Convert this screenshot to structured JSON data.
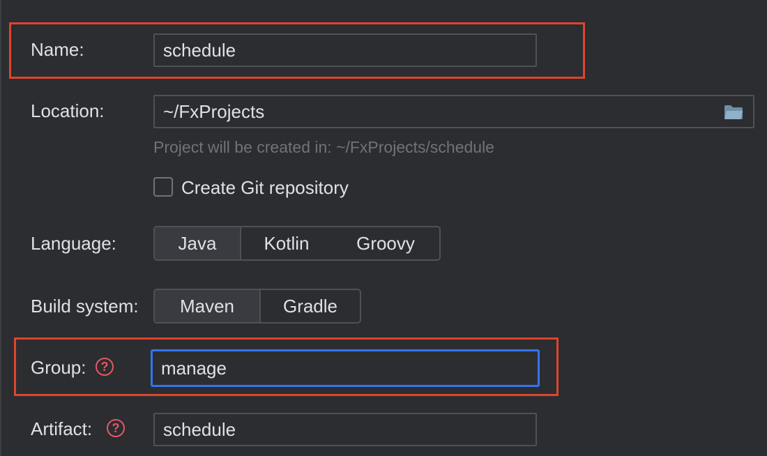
{
  "form": {
    "name": {
      "label": "Name:",
      "value": "schedule"
    },
    "location": {
      "label": "Location:",
      "value": "~/FxProjects",
      "icon": "folder-icon"
    },
    "location_hint": "Project will be created in: ~/FxProjects/schedule",
    "git": {
      "label": "Create Git repository",
      "checked": false
    },
    "language": {
      "label": "Language:",
      "options": [
        "Java",
        "Kotlin",
        "Groovy"
      ],
      "selected": "Java"
    },
    "build_system": {
      "label": "Build system:",
      "options": [
        "Maven",
        "Gradle"
      ],
      "selected": "Maven"
    },
    "group": {
      "label": "Group:",
      "value": "manage",
      "help_icon": "help-icon",
      "help_glyph": "?"
    },
    "artifact": {
      "label": "Artifact:",
      "value": "schedule",
      "help_icon": "help-icon",
      "help_glyph": "?"
    }
  },
  "colors": {
    "background": "#2b2d30",
    "text": "#dfe1e5",
    "hint": "#6f737a",
    "field_border": "#4e5157",
    "focus_border": "#3574f0",
    "annotation": "#e0442c",
    "help": "#e55765"
  }
}
